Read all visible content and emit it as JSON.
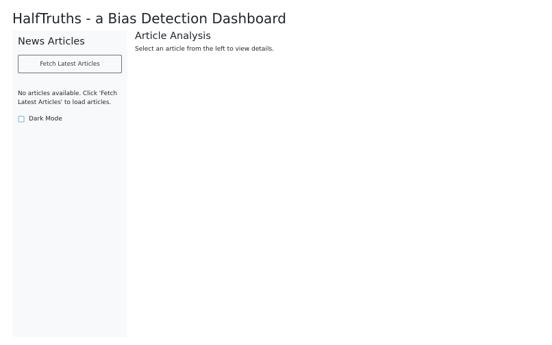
{
  "app": {
    "title": "HalfTruths - a Bias Detection Dashboard"
  },
  "sidebar": {
    "title": "News Articles",
    "fetch_button_label": "Fetch Latest Articles",
    "empty_message": "No articles available. Click 'Fetch Latest Articles' to load articles.",
    "dark_mode": {
      "label": "Dark Mode",
      "checked": false
    }
  },
  "main": {
    "title": "Article Analysis",
    "message": "Select an article from the left to view details."
  },
  "colors": {
    "sidebar_background": "#f8f9fa",
    "text": "#212529",
    "checkbox_border": "#b8d4ea"
  }
}
